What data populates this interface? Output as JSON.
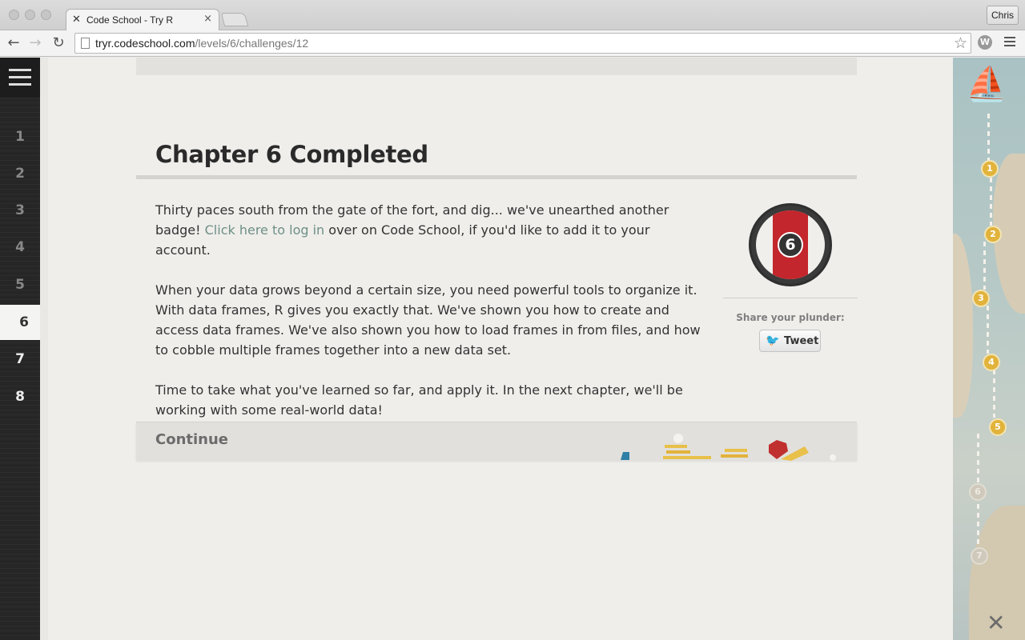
{
  "browser": {
    "tab_title": "Code School - Try R",
    "tab_icon": "crossed-tools-icon",
    "user_button": "Chris",
    "url_host": "tryr.codeschool.com",
    "url_path": "/levels/6/challenges/12"
  },
  "sidebar": {
    "levels": [
      {
        "label": "1",
        "state": "done"
      },
      {
        "label": "2",
        "state": "done"
      },
      {
        "label": "3",
        "state": "done"
      },
      {
        "label": "4",
        "state": "done"
      },
      {
        "label": "5",
        "state": "done"
      },
      {
        "label": "6",
        "state": "active"
      },
      {
        "label": "7",
        "state": "todo"
      },
      {
        "label": "8",
        "state": "todo"
      }
    ]
  },
  "content": {
    "heading": "Chapter 6 Completed",
    "para1_before_link": "Thirty paces south from the gate of the fort, and dig... we've unearthed another badge! ",
    "para1_link": "Click here to log in",
    "para1_after_link": " over on Code School, if you'd like to add it to your account.",
    "para2": "When your data grows beyond a certain size, you need powerful tools to organize it. With data frames, R gives you exactly that. We've shown you how to create and access data frames. We've also shown you how to load frames in from files, and how to cobble multiple frames together into a new data set.",
    "para3": "Time to take what you've learned so far, and apply it. In the next chapter, we'll be working with some real-world data!",
    "badge_number": "6",
    "share_label": "Share your plunder:",
    "tweet_label": "Tweet",
    "continue_label": "Continue"
  },
  "map": {
    "nodes": [
      {
        "label": "1",
        "state": "done"
      },
      {
        "label": "2",
        "state": "done"
      },
      {
        "label": "3",
        "state": "done"
      },
      {
        "label": "4",
        "state": "done"
      },
      {
        "label": "5",
        "state": "done"
      },
      {
        "label": "6",
        "state": "locked"
      },
      {
        "label": "7",
        "state": "locked"
      }
    ]
  },
  "colors": {
    "link": "#6e8f86",
    "badge_red": "#c3262c",
    "gold": "#e2b33b",
    "twitter": "#2aa3ef"
  }
}
